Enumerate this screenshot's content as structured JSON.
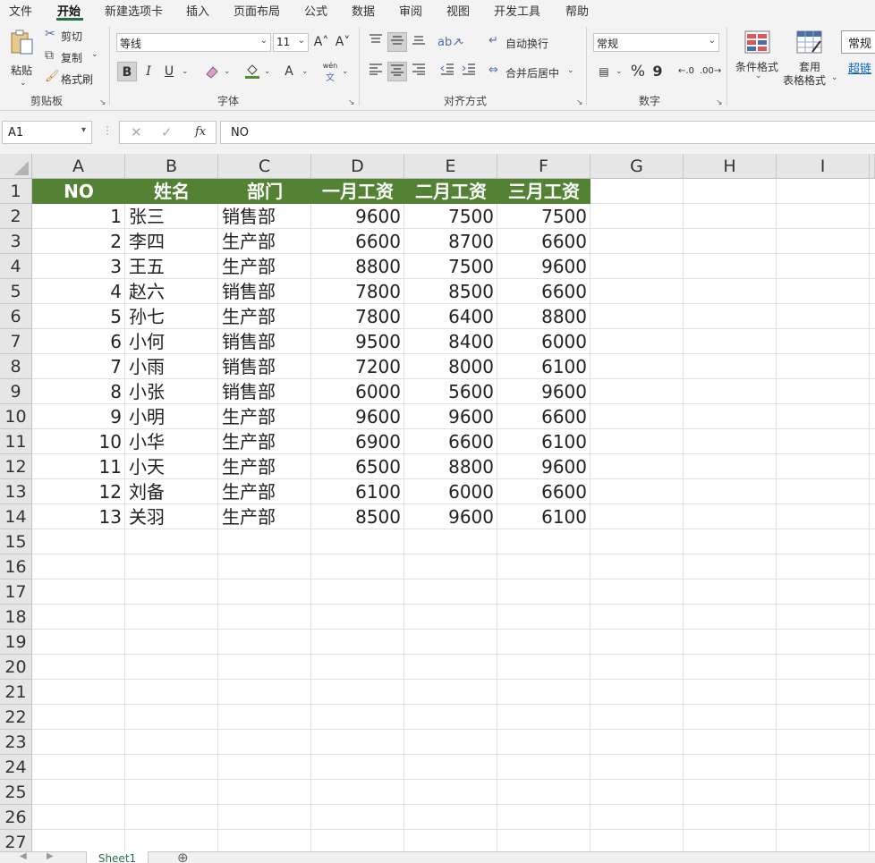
{
  "theme": {
    "accent": "#217346",
    "header_fill": "#548235",
    "header_text": "#ffffff"
  },
  "tabs": [
    {
      "label": "文件",
      "active": false
    },
    {
      "label": "开始",
      "active": true
    },
    {
      "label": "新建选项卡",
      "active": false
    },
    {
      "label": "插入",
      "active": false
    },
    {
      "label": "页面布局",
      "active": false
    },
    {
      "label": "公式",
      "active": false
    },
    {
      "label": "数据",
      "active": false
    },
    {
      "label": "审阅",
      "active": false
    },
    {
      "label": "视图",
      "active": false
    },
    {
      "label": "开发工具",
      "active": false
    },
    {
      "label": "帮助",
      "active": false
    }
  ],
  "ribbon": {
    "clipboard": {
      "paste": "粘贴",
      "cut": "剪切",
      "copy": "复制",
      "format_painter": "格式刷",
      "title": "剪贴板"
    },
    "font": {
      "name": "等线",
      "size": "11",
      "title": "字体",
      "bold": "B",
      "italic": "I",
      "underline": "U",
      "grow": "A˄",
      "shrink": "A˅",
      "font_color": "A",
      "phonetic_top": "wén",
      "phonetic_bottom": "文"
    },
    "alignment": {
      "wrap": "自动换行",
      "merge": "合并后居中",
      "title": "对齐方式"
    },
    "number": {
      "format": "常规",
      "percent": "%",
      "comma": "9",
      "title": "数字"
    },
    "styles": {
      "conditional": "条件格式",
      "table_format_line1": "套用",
      "table_format_line2": "表格格式",
      "style_normal": "常规",
      "style_hyperlink": "超链"
    }
  },
  "formula_bar": {
    "name_box": "A1",
    "fx": "fx",
    "formula": "NO"
  },
  "columns": [
    "A",
    "B",
    "C",
    "D",
    "E",
    "F",
    "G",
    "H",
    "I"
  ],
  "rows": [
    "1",
    "2",
    "3",
    "4",
    "5",
    "6",
    "7",
    "8",
    "9",
    "10",
    "11",
    "12",
    "13",
    "14",
    "15",
    "16",
    "17",
    "18",
    "19",
    "20",
    "21",
    "22",
    "23",
    "24",
    "25",
    "26",
    "27"
  ],
  "table": {
    "headers": [
      "NO",
      "姓名",
      "部门",
      "一月工资",
      "二月工资",
      "三月工资"
    ],
    "rows": [
      [
        "1",
        "张三",
        "销售部",
        "9600",
        "7500",
        "7500"
      ],
      [
        "2",
        "李四",
        "生产部",
        "6600",
        "8700",
        "6600"
      ],
      [
        "3",
        "王五",
        "生产部",
        "8800",
        "7500",
        "9600"
      ],
      [
        "4",
        "赵六",
        "销售部",
        "7800",
        "8500",
        "6600"
      ],
      [
        "5",
        "孙七",
        "生产部",
        "7800",
        "6400",
        "8800"
      ],
      [
        "6",
        "小何",
        "销售部",
        "9500",
        "8400",
        "6000"
      ],
      [
        "7",
        "小雨",
        "销售部",
        "7200",
        "8000",
        "6100"
      ],
      [
        "8",
        "小张",
        "销售部",
        "6000",
        "5600",
        "9600"
      ],
      [
        "9",
        "小明",
        "生产部",
        "9600",
        "9600",
        "6600"
      ],
      [
        "10",
        "小华",
        "生产部",
        "6900",
        "6600",
        "6100"
      ],
      [
        "11",
        "小天",
        "生产部",
        "6500",
        "8800",
        "9600"
      ],
      [
        "12",
        "刘备",
        "生产部",
        "6100",
        "6000",
        "6600"
      ],
      [
        "13",
        "关羽",
        "生产部",
        "8500",
        "9600",
        "6100"
      ]
    ]
  },
  "sheets": [
    {
      "name": "Sheet1",
      "active": true
    }
  ],
  "add_sheet": "⊕"
}
